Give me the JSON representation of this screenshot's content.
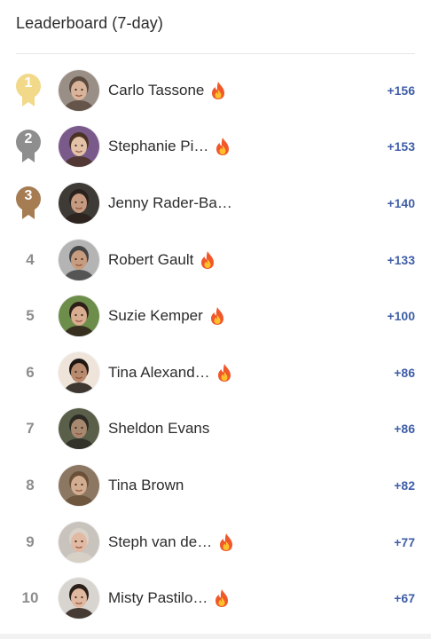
{
  "header": {
    "title": "Leaderboard (7-day)"
  },
  "colors": {
    "score": "#3e5da6",
    "gold": "#f2d98a",
    "silver": "#8e8e8e",
    "bronze": "#a67c52",
    "rank_gray": "#8d8d8d"
  },
  "leaderboard": [
    {
      "rank": "1",
      "name": "Carlo Tassone",
      "score": "+156",
      "streak": true,
      "medal": "gold",
      "avatar_bg": "#9a8f86",
      "avatar_skin": "#d9b49b",
      "avatar_hair": "#5a4a3e"
    },
    {
      "rank": "2",
      "name": "Stephanie Pi…",
      "score": "+153",
      "streak": true,
      "medal": "silver",
      "avatar_bg": "#7a5a8a",
      "avatar_skin": "#e3c2a7",
      "avatar_hair": "#4a3324"
    },
    {
      "rank": "3",
      "name": "Jenny Rader-Ba…",
      "score": "+140",
      "streak": false,
      "medal": "bronze",
      "avatar_bg": "#3e3a36",
      "avatar_skin": "#c59a80",
      "avatar_hair": "#2a211c"
    },
    {
      "rank": "4",
      "name": "Robert Gault",
      "score": "+133",
      "streak": true,
      "medal": "",
      "avatar_bg": "#b4b4b4",
      "avatar_skin": "#c89c7e",
      "avatar_hair": "#444444"
    },
    {
      "rank": "5",
      "name": "Suzie Kemper",
      "score": "+100",
      "streak": true,
      "medal": "",
      "avatar_bg": "#6c8e4a",
      "avatar_skin": "#d9ad8f",
      "avatar_hair": "#2e2019"
    },
    {
      "rank": "6",
      "name": "Tina Alexand…",
      "score": "+86",
      "streak": true,
      "medal": "",
      "avatar_bg": "#efe4da",
      "avatar_skin": "#b88a6e",
      "avatar_hair": "#1f1712"
    },
    {
      "rank": "7",
      "name": "Sheldon Evans",
      "score": "+86",
      "streak": false,
      "medal": "",
      "avatar_bg": "#5a5f4a",
      "avatar_skin": "#a8896f",
      "avatar_hair": "#2d2a24"
    },
    {
      "rank": "8",
      "name": "Tina Brown",
      "score": "+82",
      "streak": false,
      "medal": "",
      "avatar_bg": "#8b7762",
      "avatar_skin": "#d2ad90",
      "avatar_hair": "#6a5038"
    },
    {
      "rank": "9",
      "name": "Steph van de…",
      "score": "+77",
      "streak": true,
      "medal": "",
      "avatar_bg": "#c9c3bd",
      "avatar_skin": "#e2b9a2",
      "avatar_hair": "#d9d2c8"
    },
    {
      "rank": "10",
      "name": "Misty Pastilo…",
      "score": "+67",
      "streak": true,
      "medal": "",
      "avatar_bg": "#d8d4cf",
      "avatar_skin": "#e0b9a0",
      "avatar_hair": "#2b2019"
    }
  ]
}
